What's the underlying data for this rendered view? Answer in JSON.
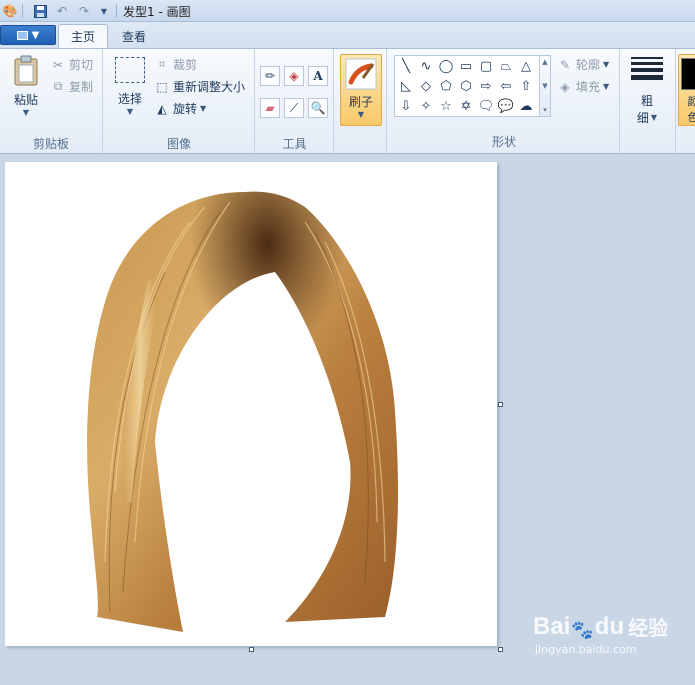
{
  "window": {
    "title": "发型1 - 画图"
  },
  "tabs": [
    {
      "label": "主页",
      "active": true
    },
    {
      "label": "查看",
      "active": false
    }
  ],
  "clipboard": {
    "paste_label": "粘贴",
    "cut_label": "剪切",
    "copy_label": "复制",
    "group_label": "剪贴板"
  },
  "image": {
    "select_label": "选择",
    "crop_label": "裁剪",
    "resize_label": "重新调整大小",
    "rotate_label": "旋转",
    "group_label": "图像"
  },
  "tools": {
    "group_label": "工具"
  },
  "brushes": {
    "label": "刷子"
  },
  "shapes": {
    "outline_label": "轮廓",
    "fill_label": "填充",
    "group_label": "形状"
  },
  "size": {
    "label_line1": "粗",
    "label_line2": "细"
  },
  "colors": {
    "partial_label_line1": "颜",
    "partial_label_line2": "色",
    "accent": "#f7d78a"
  },
  "watermark": {
    "brand": "Bai",
    "brand2": "du",
    "cn": "经验",
    "url": "jingyan.baidu.com"
  }
}
